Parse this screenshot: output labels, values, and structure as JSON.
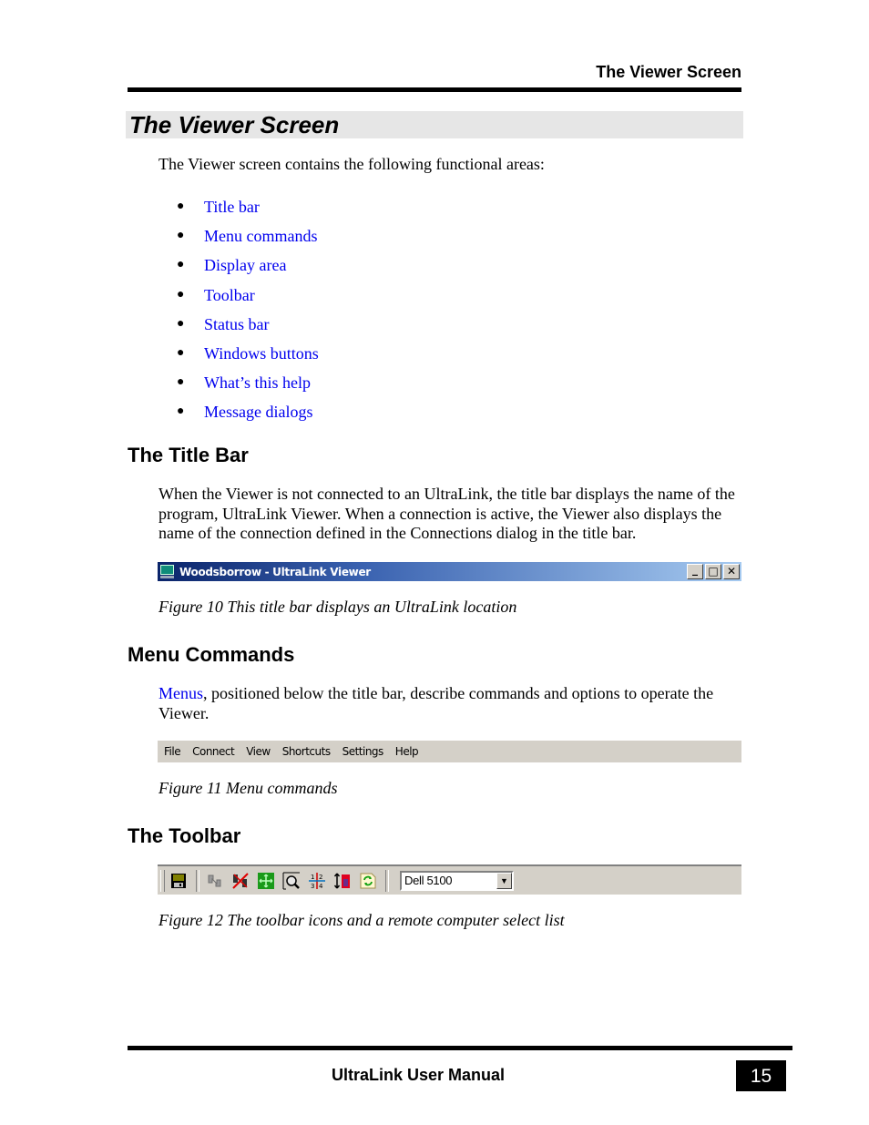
{
  "running_head": "The Viewer Screen",
  "section_title": "The Viewer Screen",
  "intro": "The Viewer screen contains the following functional areas:",
  "functional_areas": [
    "Title bar",
    "Menu commands",
    "Display area",
    "Toolbar",
    "Status bar",
    "Windows buttons",
    "What’s this help",
    "Message dialogs"
  ],
  "colors": {
    "link": "#0000ee",
    "section_band": "#e6e6e6",
    "window_chrome": "#d4d0c8",
    "titlebar_start": "#0a246a",
    "titlebar_end": "#a6caf0"
  },
  "title_bar_section": {
    "heading": "The Title Bar",
    "paragraph": "When the Viewer is not connected to an UltraLink, the title bar displays the name of the program, UltraLink Viewer. When a connection is active, the Viewer also displays the name of the connection defined in the Connections dialog in the title bar.",
    "figure": {
      "window_title": "Woodsborrow - UltraLink Viewer",
      "app_icon": "monitor-icon",
      "buttons": [
        {
          "name": "minimize",
          "glyph": "_"
        },
        {
          "name": "maximize",
          "glyph": "□"
        },
        {
          "name": "close",
          "glyph": "✕"
        }
      ]
    },
    "caption": "Figure 10 This title bar displays an UltraLink location"
  },
  "menu_section": {
    "heading": "Menu Commands",
    "link_text": "Menus",
    "paragraph_rest": ", positioned below the title bar, describe commands and options to operate the Viewer.",
    "figure": {
      "menu_items": [
        "File",
        "Connect",
        "View",
        "Shortcuts",
        "Settings",
        "Help"
      ]
    },
    "caption": "Figure 11 Menu commands"
  },
  "toolbar_section": {
    "heading": "The Toolbar",
    "figure": {
      "icons": [
        "save-icon",
        "connect-icon",
        "disconnect-icon",
        "fit-screen-icon",
        "zoom-icon",
        "split-screen-icon",
        "scale-icon",
        "refresh-icon"
      ],
      "computer_select": {
        "value": "Dell 5100",
        "arrow": "▼"
      }
    },
    "caption": "Figure 12 The toolbar icons and a remote computer select list"
  },
  "footer": {
    "title": "UltraLink User Manual",
    "page_number": "15"
  }
}
